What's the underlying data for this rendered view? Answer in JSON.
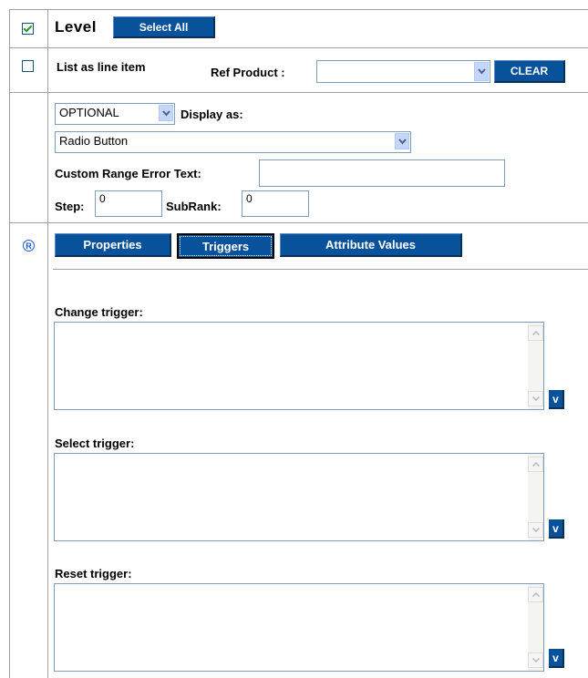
{
  "row_level": {
    "label": "Level",
    "checked": true,
    "select_all_label": "Select All"
  },
  "row_line_item": {
    "label": "List as line item",
    "checked": false,
    "ref_product_label": "Ref Product :",
    "ref_product_value": "",
    "clear_label": "CLEAR"
  },
  "row_options": {
    "optional_value": "OPTIONAL",
    "display_as_label": "Display as:",
    "display_as_value": "Radio Button",
    "custom_range_label": "Custom Range Error Text:",
    "custom_range_value": "",
    "step_label": "Step:",
    "step_value": "0",
    "subrank_label": "SubRank:",
    "subrank_value": "0"
  },
  "row_tabs": {
    "radio_icon": "registered-icon",
    "radio_glyph": "R",
    "tabs": [
      {
        "label": "Properties",
        "active": false
      },
      {
        "label": "Triggers",
        "active": true
      },
      {
        "label": "Attribute Values",
        "active": false
      }
    ]
  },
  "triggers": [
    {
      "label": "Change trigger:",
      "value": "",
      "v_label": "v"
    },
    {
      "label": "Select trigger:",
      "value": "",
      "v_label": "v"
    },
    {
      "label": "Reset trigger:",
      "value": "",
      "v_label": "v"
    }
  ],
  "colors": {
    "button_blue": "#08529c",
    "input_border": "#7f9db9",
    "grid_line": "#a0a0a0"
  }
}
